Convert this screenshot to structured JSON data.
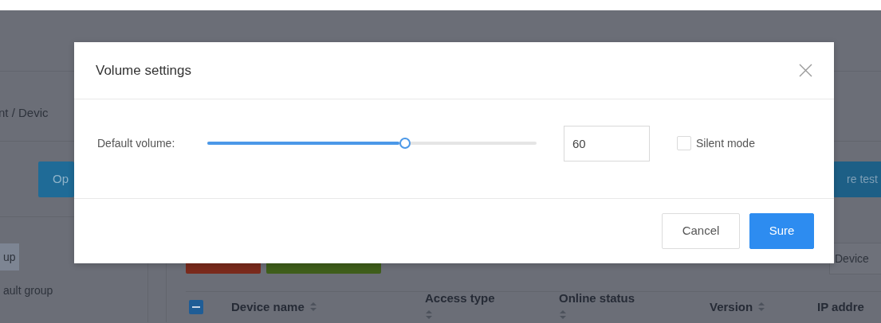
{
  "page": {
    "breadcrumb": "nt / Devic",
    "sidebar": {
      "button": "Op",
      "groups": [
        {
          "label": "up",
          "selected": true
        },
        {
          "label": "ault group",
          "selected": false
        }
      ]
    },
    "toolbar": {
      "button": "re test",
      "search": {
        "placeholder": "Device"
      },
      "action_buttons": [
        {
          "color": "#7a2a1c"
        },
        {
          "color": "#3f5e1b"
        }
      ]
    },
    "table": {
      "select_all": {
        "indeterminate": true
      },
      "columns": [
        {
          "label": "Device name",
          "sortable": true
        },
        {
          "label": "Access type",
          "sortable": true
        },
        {
          "label": "Online status",
          "sortable": true
        },
        {
          "label": "Version",
          "sortable": true
        },
        {
          "label": "IP addre",
          "sortable": false
        }
      ]
    }
  },
  "modal": {
    "title": "Volume settings",
    "volume_label": "Default volume:",
    "volume": {
      "level": 0.6
    },
    "volume_value": "60",
    "silent_mode": {
      "label": "Silent mode",
      "checked": false
    },
    "buttons": [
      {
        "label": "Cancel",
        "kind": "default"
      },
      {
        "label": "Sure",
        "kind": "primary"
      }
    ]
  }
}
